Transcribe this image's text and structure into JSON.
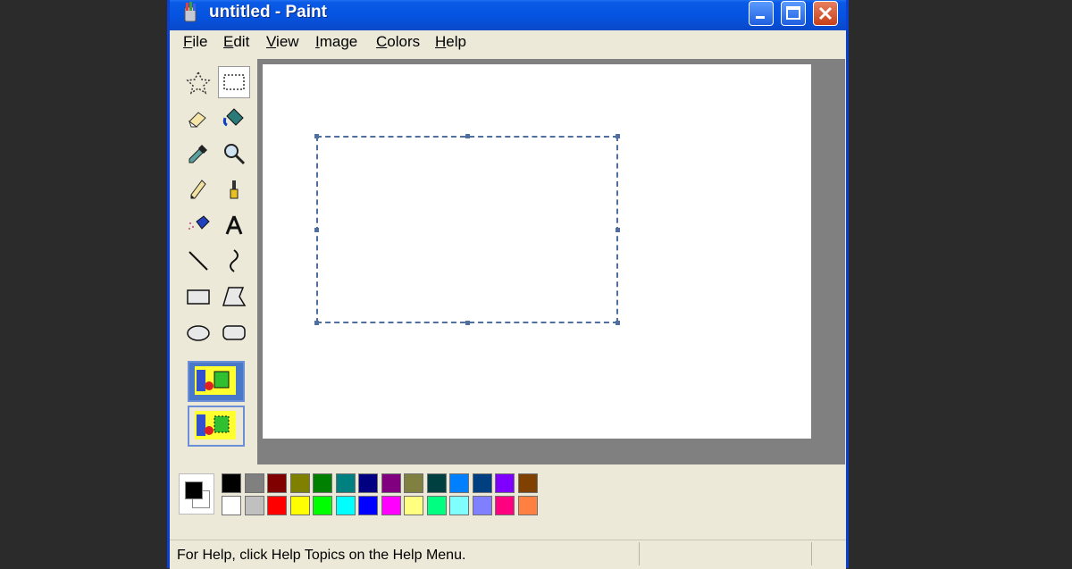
{
  "window": {
    "title": "untitled - Paint",
    "controls": [
      "minimize-icon",
      "maximize-icon",
      "close-icon"
    ]
  },
  "menu": {
    "items": [
      {
        "label": "File",
        "key": "F"
      },
      {
        "label": "Edit",
        "key": "E"
      },
      {
        "label": "View",
        "key": "V"
      },
      {
        "label": "Image",
        "key": "I"
      },
      {
        "label": "Colors",
        "key": "C"
      },
      {
        "label": "Help",
        "key": "H"
      }
    ]
  },
  "tools": [
    {
      "name": "free-form-select-icon"
    },
    {
      "name": "rectangle-select-icon",
      "selected": true
    },
    {
      "name": "eraser-icon"
    },
    {
      "name": "fill-bucket-icon"
    },
    {
      "name": "pick-color-icon"
    },
    {
      "name": "magnifier-icon"
    },
    {
      "name": "pencil-icon"
    },
    {
      "name": "brush-icon"
    },
    {
      "name": "airbrush-icon"
    },
    {
      "name": "text-icon",
      "glyph": "A"
    },
    {
      "name": "line-icon"
    },
    {
      "name": "curve-icon"
    },
    {
      "name": "rectangle-icon"
    },
    {
      "name": "polygon-icon"
    },
    {
      "name": "ellipse-icon"
    },
    {
      "name": "rounded-rectangle-icon"
    }
  ],
  "palette": {
    "foreground": "#000000",
    "background": "#ffffff",
    "row1": [
      "#000000",
      "#808080",
      "#800000",
      "#808000",
      "#008000",
      "#008080",
      "#000080",
      "#800080",
      "#808040",
      "#004040",
      "#0080ff",
      "#004080",
      "#8000ff",
      "#804000"
    ],
    "row2": [
      "#ffffff",
      "#c0c0c0",
      "#ff0000",
      "#ffff00",
      "#00ff00",
      "#00ffff",
      "#0000ff",
      "#ff00ff",
      "#ffff80",
      "#00ff80",
      "#80ffff",
      "#8080ff",
      "#ff0080",
      "#ff8040"
    ]
  },
  "status": {
    "text": "For Help, click Help Topics on the Help Menu."
  }
}
